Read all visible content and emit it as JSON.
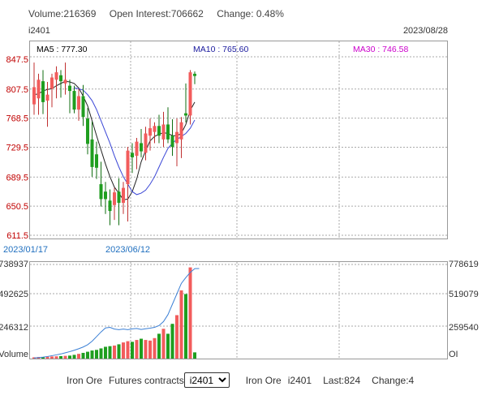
{
  "header": {
    "volume_text": "Volume:216369",
    "open_interest_text": "Open Interest:706662",
    "change_text": "Change: 0.48%",
    "contract_label": "i2401",
    "last_date": "2023/08/28"
  },
  "legend": {
    "ma5": "MA5 : 777.30",
    "ma10": "MA10 : 765.60",
    "ma30": "MA30 : 746.58"
  },
  "colors": {
    "up": "#f25c5c",
    "down": "#1f9e1f",
    "ma5": "#222222",
    "ma10": "#3a46d6",
    "ma30": "#cc00cc",
    "oi_line": "#3a7fd5",
    "price_axis": "#c00000",
    "date_axis": "#1f6fbf"
  },
  "price_axis": {
    "ticks": [
      "847.5",
      "807.5",
      "768.5",
      "729.5",
      "689.5",
      "650.5",
      "611.5"
    ]
  },
  "date_axis": {
    "ticks": [
      "2023/01/17",
      "2023/06/12"
    ]
  },
  "volume_axis": {
    "left_ticks": [
      "738937",
      "492625",
      "246312"
    ],
    "left_label": "Volume",
    "right_ticks": [
      "778619",
      "519079",
      "259540"
    ],
    "right_label": "OI"
  },
  "chart_data": [
    {
      "type": "candlestick",
      "title": "i2401",
      "ylim": [
        611.5,
        847.5
      ],
      "candles": [
        {
          "o": 787,
          "h": 843,
          "l": 773,
          "c": 810
        },
        {
          "o": 795,
          "h": 828,
          "l": 773,
          "c": 820
        },
        {
          "o": 818,
          "h": 833,
          "l": 774,
          "c": 790
        },
        {
          "o": 792,
          "h": 817,
          "l": 757,
          "c": 800
        },
        {
          "o": 808,
          "h": 828,
          "l": 783,
          "c": 823
        },
        {
          "o": 820,
          "h": 838,
          "l": 795,
          "c": 830
        },
        {
          "o": 826,
          "h": 833,
          "l": 796,
          "c": 818
        },
        {
          "o": 815,
          "h": 843,
          "l": 800,
          "c": 820
        },
        {
          "o": 812,
          "h": 820,
          "l": 775,
          "c": 805
        },
        {
          "o": 805,
          "h": 812,
          "l": 775,
          "c": 780
        },
        {
          "o": 780,
          "h": 808,
          "l": 765,
          "c": 798
        },
        {
          "o": 798,
          "h": 813,
          "l": 758,
          "c": 770
        },
        {
          "o": 768,
          "h": 782,
          "l": 720,
          "c": 734
        },
        {
          "o": 740,
          "h": 764,
          "l": 690,
          "c": 703
        },
        {
          "o": 720,
          "h": 737,
          "l": 687,
          "c": 702
        },
        {
          "o": 680,
          "h": 710,
          "l": 650,
          "c": 660
        },
        {
          "o": 670,
          "h": 683,
          "l": 640,
          "c": 660
        },
        {
          "o": 658,
          "h": 673,
          "l": 625,
          "c": 644
        },
        {
          "o": 652,
          "h": 675,
          "l": 632,
          "c": 669
        },
        {
          "o": 670,
          "h": 688,
          "l": 625,
          "c": 655
        },
        {
          "o": 655,
          "h": 683,
          "l": 640,
          "c": 675
        },
        {
          "o": 680,
          "h": 730,
          "l": 630,
          "c": 725
        },
        {
          "o": 722,
          "h": 735,
          "l": 695,
          "c": 716
        },
        {
          "o": 718,
          "h": 742,
          "l": 700,
          "c": 737
        },
        {
          "o": 735,
          "h": 754,
          "l": 716,
          "c": 724
        },
        {
          "o": 722,
          "h": 757,
          "l": 712,
          "c": 748
        },
        {
          "o": 745,
          "h": 768,
          "l": 725,
          "c": 755
        },
        {
          "o": 750,
          "h": 763,
          "l": 735,
          "c": 758
        },
        {
          "o": 758,
          "h": 773,
          "l": 735,
          "c": 745
        },
        {
          "o": 740,
          "h": 777,
          "l": 730,
          "c": 760
        },
        {
          "o": 760,
          "h": 783,
          "l": 735,
          "c": 740
        },
        {
          "o": 745,
          "h": 767,
          "l": 718,
          "c": 730
        },
        {
          "o": 735,
          "h": 768,
          "l": 704,
          "c": 750
        },
        {
          "o": 740,
          "h": 770,
          "l": 715,
          "c": 763
        },
        {
          "o": 775,
          "h": 815,
          "l": 763,
          "c": 772
        },
        {
          "o": 772,
          "h": 833,
          "l": 760,
          "c": 830
        },
        {
          "o": 828,
          "h": 831,
          "l": 814,
          "c": 825
        }
      ],
      "ma5": [
        800,
        801,
        805,
        807,
        808,
        812,
        815,
        818,
        817,
        815,
        809,
        798,
        785,
        765,
        745,
        726,
        707,
        690,
        676,
        668,
        659,
        660,
        670,
        687,
        710,
        725,
        738,
        744,
        747,
        749,
        748,
        745,
        745,
        748,
        760,
        779,
        790
      ],
      "ma10": [
        null,
        null,
        null,
        null,
        null,
        null,
        null,
        null,
        null,
        809,
        808,
        806,
        800,
        792,
        780,
        765,
        750,
        735,
        718,
        703,
        690,
        680,
        670,
        666,
        668,
        672,
        680,
        690,
        703,
        716,
        728,
        735,
        740,
        744,
        748,
        755,
        766
      ]
    },
    {
      "type": "bar",
      "title": "",
      "ylim": [
        0,
        738937
      ],
      "volume": [
        10000,
        12000,
        11000,
        15000,
        17000,
        18000,
        20000,
        22000,
        24000,
        30000,
        38000,
        46000,
        55000,
        65000,
        70000,
        82000,
        95000,
        100000,
        105000,
        115000,
        130000,
        140000,
        135000,
        150000,
        160000,
        150000,
        145000,
        165000,
        200000,
        240000,
        200000,
        280000,
        350000,
        550000,
        520000,
        735000,
        50000
      ],
      "oi": [
        5000,
        9000,
        12000,
        18000,
        25000,
        32000,
        40000,
        50000,
        60000,
        72000,
        85000,
        100000,
        120000,
        150000,
        190000,
        230000,
        265000,
        270000,
        255000,
        250000,
        255000,
        250000,
        257000,
        260000,
        252000,
        258000,
        263000,
        270000,
        285000,
        320000,
        380000,
        470000,
        560000,
        650000,
        700000,
        745000,
        778000,
        778619
      ]
    }
  ],
  "footer": {
    "product_label": "Iron Ore",
    "futures_label": "Futures contracts",
    "select_value": "i2401",
    "select_options": [
      "i2401"
    ],
    "info_product": "Iron Ore",
    "info_contract": "i2401",
    "last_text": "Last:824",
    "change_text": "Change:4"
  }
}
